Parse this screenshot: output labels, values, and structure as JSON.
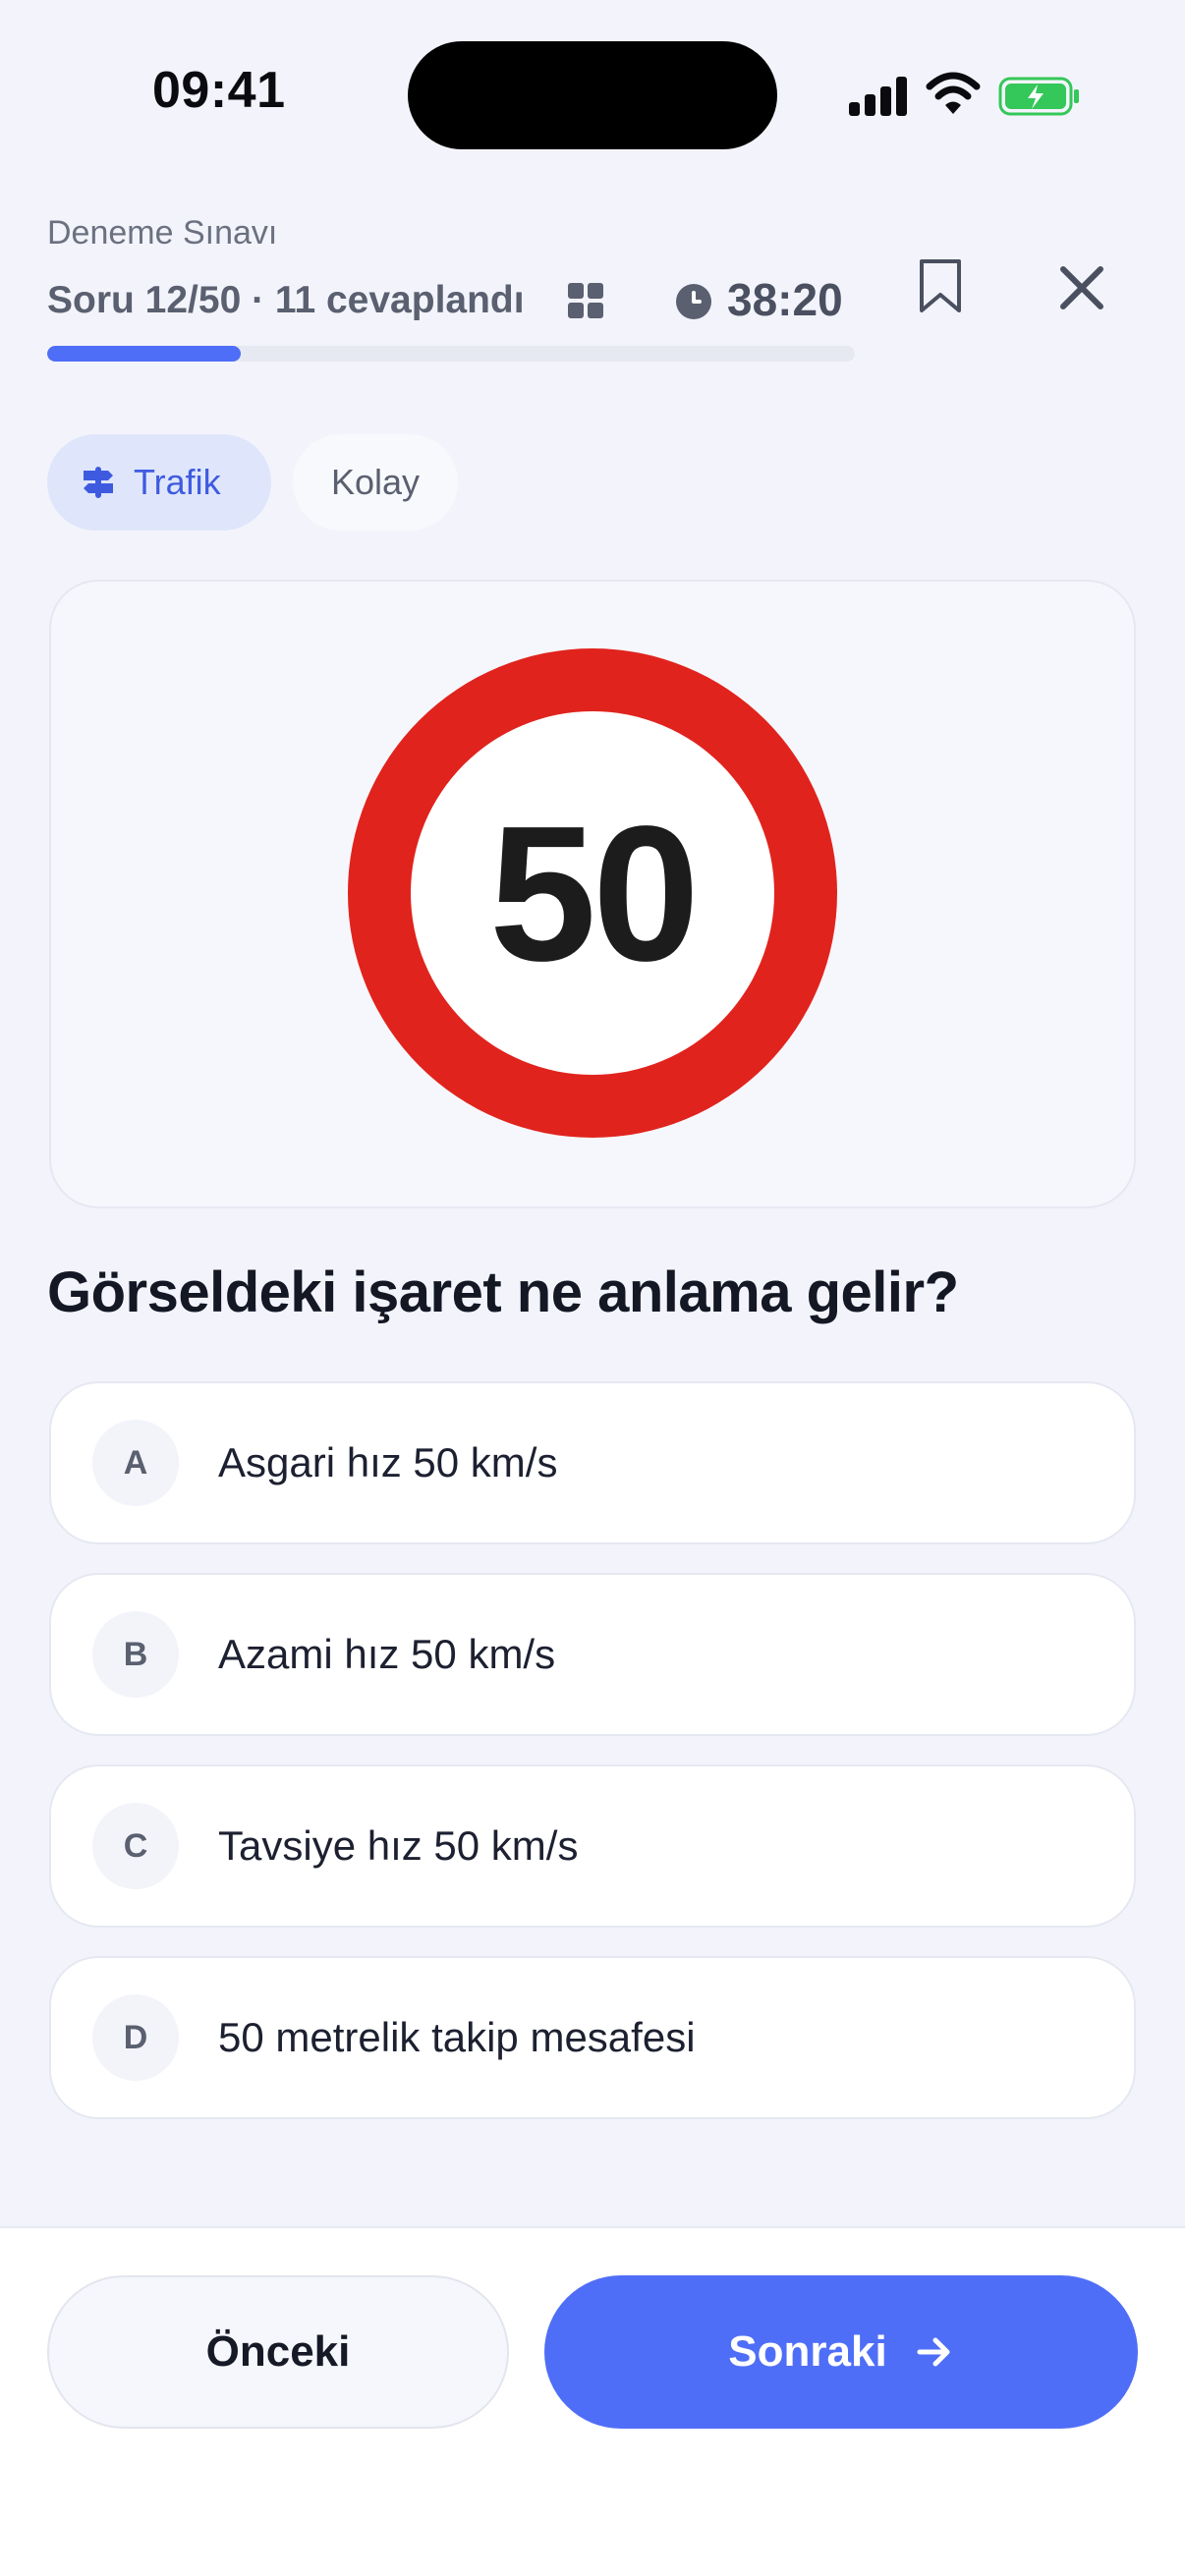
{
  "status_bar": {
    "time": "09:41"
  },
  "header": {
    "exam_title": "Deneme Sınavı",
    "progress_text": "Soru 12/50 · 11 cevaplandı",
    "timer": "38:20",
    "progress_fraction": 0.24
  },
  "chips": {
    "category": "Trafik",
    "difficulty": "Kolay"
  },
  "sign": {
    "value": "50"
  },
  "question": "Görseldeki işaret ne anlama gelir?",
  "options": [
    {
      "letter": "A",
      "text": "Asgari hız 50 km/s"
    },
    {
      "letter": "B",
      "text": "Azami hız 50 km/s"
    },
    {
      "letter": "C",
      "text": "Tavsiye hız 50 km/s"
    },
    {
      "letter": "D",
      "text": "50 metrelik takip mesafesi"
    }
  ],
  "footer": {
    "prev_label": "Önceki",
    "next_label": "Sonraki"
  },
  "colors": {
    "accent": "#4f6ef7",
    "sign_red": "#e1231d"
  }
}
